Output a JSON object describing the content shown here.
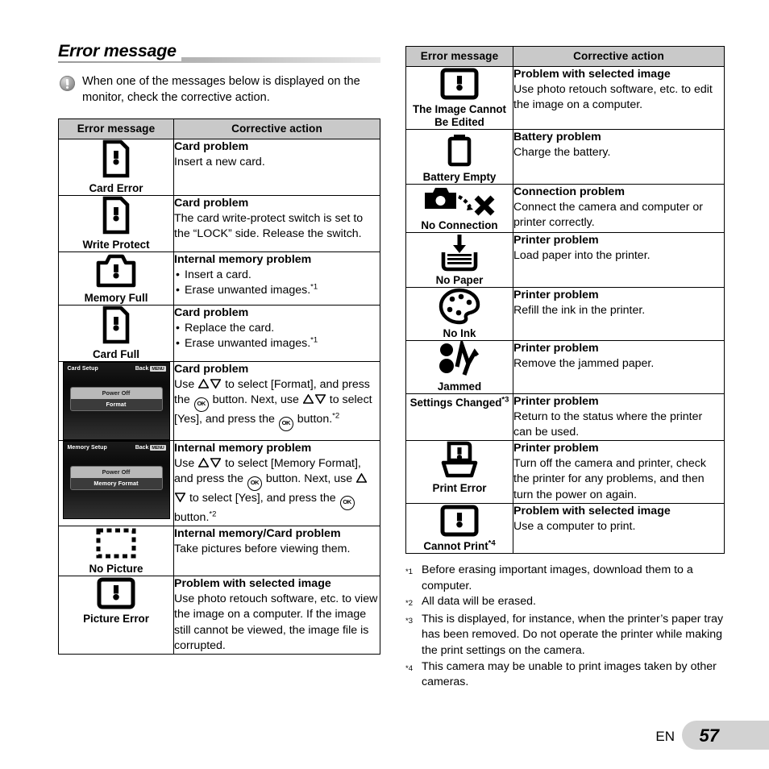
{
  "heading": "Error message",
  "note": "When one of the messages below is displayed on the monitor, check the corrective action.",
  "note_icon": "exclamation-circle-icon",
  "table_headers": {
    "message": "Error message",
    "action": "Corrective action"
  },
  "left_table": [
    {
      "icon": "card-error-icon",
      "label": "Card Error",
      "action_title": "Card problem",
      "action_body": "Insert a new card."
    },
    {
      "icon": "card-write-protect-icon",
      "label": "Write Protect",
      "action_title": "Card problem",
      "action_body": "The card write-protect switch is set to the “LOCK” side. Release the switch."
    },
    {
      "icon": "camera-memory-full-icon",
      "label": "Memory Full",
      "action_title": "Internal memory problem",
      "bullets": [
        "Insert a card.",
        "Erase unwanted images."
      ],
      "bullet_footnotes": [
        "",
        "1"
      ]
    },
    {
      "icon": "card-full-icon",
      "label": "Card Full",
      "action_title": "Card problem",
      "bullets": [
        "Replace the card.",
        "Erase unwanted images."
      ],
      "bullet_footnotes": [
        "",
        "1"
      ]
    },
    {
      "icon": "card-setup-screenshot",
      "screen": {
        "title": "Card Setup",
        "back_label": "Back",
        "menu_chip": "MENU",
        "rows": [
          {
            "label": "Power Off",
            "highlighted": true
          },
          {
            "label": "Format",
            "highlighted": false
          }
        ]
      },
      "action_title": "Card problem",
      "action_rich": [
        {
          "t": "Use "
        },
        {
          "g": "tri-up"
        },
        {
          "g": "tri-down"
        },
        {
          "t": " to select [Format], and press the "
        },
        {
          "g": "ok"
        },
        {
          "t": " button. Next, use "
        },
        {
          "g": "tri-up"
        },
        {
          "g": "tri-down"
        },
        {
          "t": " to select [Yes], and press the "
        },
        {
          "g": "ok"
        },
        {
          "t": " button."
        },
        {
          "fn": "2"
        }
      ]
    },
    {
      "icon": "memory-setup-screenshot",
      "screen": {
        "title": "Memory Setup",
        "back_label": "Back",
        "menu_chip": "MENU",
        "rows": [
          {
            "label": "Power Off",
            "highlighted": true
          },
          {
            "label": "Memory Format",
            "highlighted": false
          }
        ]
      },
      "action_title": "Internal memory problem",
      "action_rich": [
        {
          "t": "Use "
        },
        {
          "g": "tri-up"
        },
        {
          "g": "tri-down"
        },
        {
          "t": " to select [Memory Format], and press the "
        },
        {
          "g": "ok"
        },
        {
          "t": " button. Next, use "
        },
        {
          "g": "tri-up"
        },
        {
          "g": "tri-down"
        },
        {
          "t": " to select [Yes], and press the "
        },
        {
          "g": "ok"
        },
        {
          "t": " button."
        },
        {
          "fn": "2"
        }
      ]
    },
    {
      "icon": "no-picture-icon",
      "label": "No Picture",
      "action_title": "Internal memory/Card problem",
      "action_body": "Take pictures before viewing them."
    },
    {
      "icon": "picture-error-icon",
      "label": "Picture Error",
      "action_title": "Problem with selected image",
      "action_body": "Use photo retouch software, etc. to view the image on a computer. If the image still cannot be viewed, the image file is corrupted."
    }
  ],
  "right_table": [
    {
      "icon": "image-cannot-be-edited-icon",
      "label": "The Image Cannot Be Edited",
      "action_title": "Problem with selected image",
      "action_body": "Use photo retouch software, etc. to edit the image on a computer."
    },
    {
      "icon": "battery-empty-icon",
      "label": "Battery Empty",
      "action_title": "Battery problem",
      "action_body": "Charge the battery."
    },
    {
      "icon": "no-connection-icon",
      "label": "No Connection",
      "action_title": "Connection problem",
      "action_body": "Connect the camera and computer or printer correctly."
    },
    {
      "icon": "no-paper-icon",
      "label": "No Paper",
      "action_title": "Printer problem",
      "action_body": "Load paper into the printer."
    },
    {
      "icon": "no-ink-icon",
      "label": "No Ink",
      "action_title": "Printer problem",
      "action_body": "Refill the ink in the printer."
    },
    {
      "icon": "paper-jammed-icon",
      "label": "Jammed",
      "action_title": "Printer problem",
      "action_body": "Remove the jammed paper."
    },
    {
      "icon": "none",
      "label": "Settings Changed",
      "label_footnote": "3",
      "action_title": "Printer problem",
      "action_body": "Return to the status where the printer can be used."
    },
    {
      "icon": "print-error-icon",
      "label": "Print Error",
      "action_title": "Printer problem",
      "action_body": "Turn off the camera and printer, check the printer for any problems, and then turn the power on again."
    },
    {
      "icon": "cannot-print-icon",
      "label": "Cannot Print",
      "label_footnote": "4",
      "action_title": "Problem with selected image",
      "action_body": "Use a computer to print."
    }
  ],
  "footnotes": [
    {
      "mark": "*1",
      "text": "Before erasing important images, download them to a computer."
    },
    {
      "mark": "*2",
      "text": "All data will be erased."
    },
    {
      "mark": "*3",
      "text": "This is displayed, for instance, when the printer’s paper tray has been removed. Do not operate the printer while making the print settings on the camera."
    },
    {
      "mark": "*4",
      "text": "This camera may be unable to print images taken by other cameras."
    }
  ],
  "footer": {
    "language": "EN",
    "page_number": "57"
  }
}
